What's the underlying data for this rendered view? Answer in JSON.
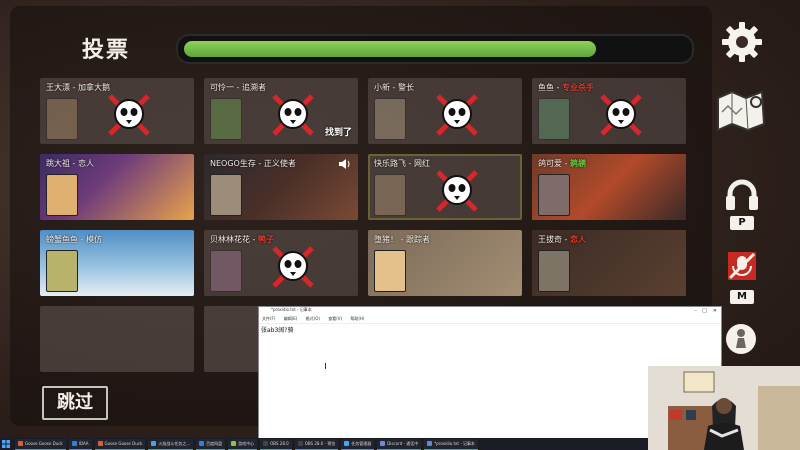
{
  "vote": {
    "title": "投票",
    "timer_fraction": 0.82,
    "skip_label": "跳过",
    "found_label": "找到了"
  },
  "players": [
    {
      "name": "王大漂",
      "role": "加拿大鹅",
      "role_color": "normal",
      "status": "dead",
      "row": 0,
      "col": 0
    },
    {
      "name": "可怜一",
      "role": "追溯者",
      "role_color": "normal",
      "status": "dead",
      "row": 0,
      "col": 1,
      "found": true
    },
    {
      "name": "小新",
      "role": "警长",
      "role_color": "normal",
      "status": "dead",
      "row": 0,
      "col": 2
    },
    {
      "name": "鱼鱼",
      "role": "专业杀手",
      "role_color": "red",
      "status": "dead",
      "row": 0,
      "col": 3
    },
    {
      "name": "跳大祖",
      "role": "恋人",
      "role_color": "normal",
      "status": "alive",
      "row": 1,
      "col": 0,
      "theme": "rabbit"
    },
    {
      "name": "NEOGO生存",
      "role": "正义使者",
      "role_color": "normal",
      "status": "alive",
      "row": 1,
      "col": 1,
      "theme": "judge",
      "speaking": true
    },
    {
      "name": "快乐路飞",
      "role": "网红",
      "role_color": "normal",
      "status": "dead",
      "row": 1,
      "col": 2,
      "recorded": true
    },
    {
      "name": "鸽可爱",
      "role": "鹈鹕",
      "role_color": "green",
      "status": "alive",
      "row": 1,
      "col": 3,
      "theme": "pelican",
      "highlight": true
    },
    {
      "name": "螃蟹鱼鱼",
      "role": "模仿",
      "role_color": "normal",
      "status": "alive",
      "row": 2,
      "col": 0,
      "theme": "sky"
    },
    {
      "name": "贝林林花花",
      "role": "鸭子",
      "role_color": "red",
      "status": "dead",
      "row": 2,
      "col": 1
    },
    {
      "name": "堕猪！",
      "role": "跟踪者",
      "role_color": "normal",
      "status": "alive",
      "row": 2,
      "col": 2,
      "theme": "cards"
    },
    {
      "name": "王拔奇",
      "role": "恋人",
      "role_color": "red",
      "status": "alive",
      "row": 2,
      "col": 3,
      "theme": "room"
    }
  ],
  "side_icons": [
    {
      "name": "settings-gear-icon"
    },
    {
      "name": "map-icon"
    },
    {
      "name": "headphones-icon",
      "key": "P"
    },
    {
      "name": "muted-mic-icon",
      "key": "M"
    },
    {
      "name": "pawn-icon"
    }
  ],
  "notepad": {
    "title": "*proxidio.txt - 记事本",
    "menus": [
      "文件(F)",
      "编辑(E)",
      "格式(O)",
      "查看(V)",
      "帮助(H)"
    ],
    "text": "张ab3阔?骑"
  },
  "taskbar": {
    "items": [
      "Goose Goose Duck",
      "IDAA",
      "Goose Goose Duck",
      "火焰战斗任务之...",
      "百度网盘",
      "游戏中心",
      "OBS 28.0",
      "OBS 28.0 - 预览",
      "任务管理器",
      "Discord - 通话中",
      "*proxidio.txt - 记事本"
    ]
  },
  "colors": {
    "timer_fill": "#7ec34e",
    "highlight_border": "#e6a81d",
    "role_red": "#e23b2c",
    "role_green": "#62c940"
  }
}
